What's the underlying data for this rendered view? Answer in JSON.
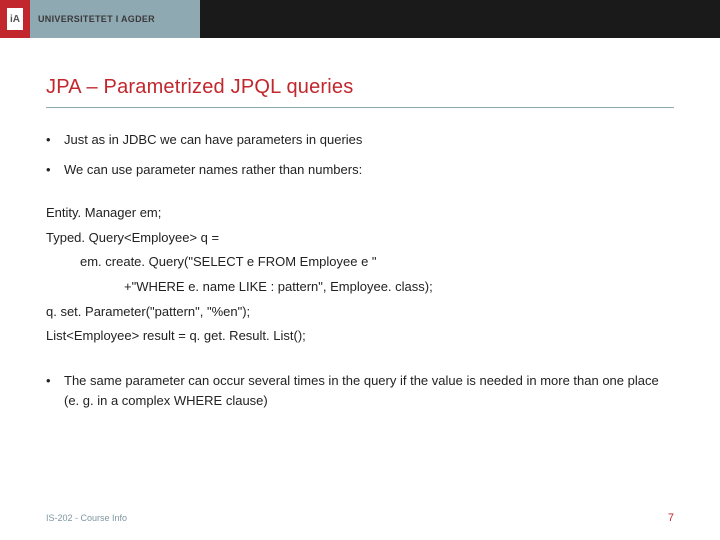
{
  "brand": {
    "monogram": "iA",
    "name": "UNIVERSITETET I AGDER"
  },
  "slide": {
    "title": "JPA – Parametrized JPQL queries",
    "bullets_top": [
      "Just as in JDBC we can have parameters in queries",
      "We can use parameter names rather than numbers:"
    ],
    "code": {
      "l1": "Entity. Manager em;",
      "l2": "Typed. Query<Employee> q =",
      "l3": "em. create. Query(\"SELECT e FROM Employee e \"",
      "l4": "+\"WHERE e. name LIKE : pattern\", Employee. class);",
      "l5": "q. set. Parameter(\"pattern\", \"%en\");",
      "l6": "List<Employee> result = q. get. Result. List();"
    },
    "bullets_bottom": [
      "The same parameter can occur several times in the query if the value is needed in more than one place (e. g. in a complex WHERE clause)"
    ]
  },
  "footer": {
    "left": "IS-202 - Course Info",
    "page": "7"
  }
}
